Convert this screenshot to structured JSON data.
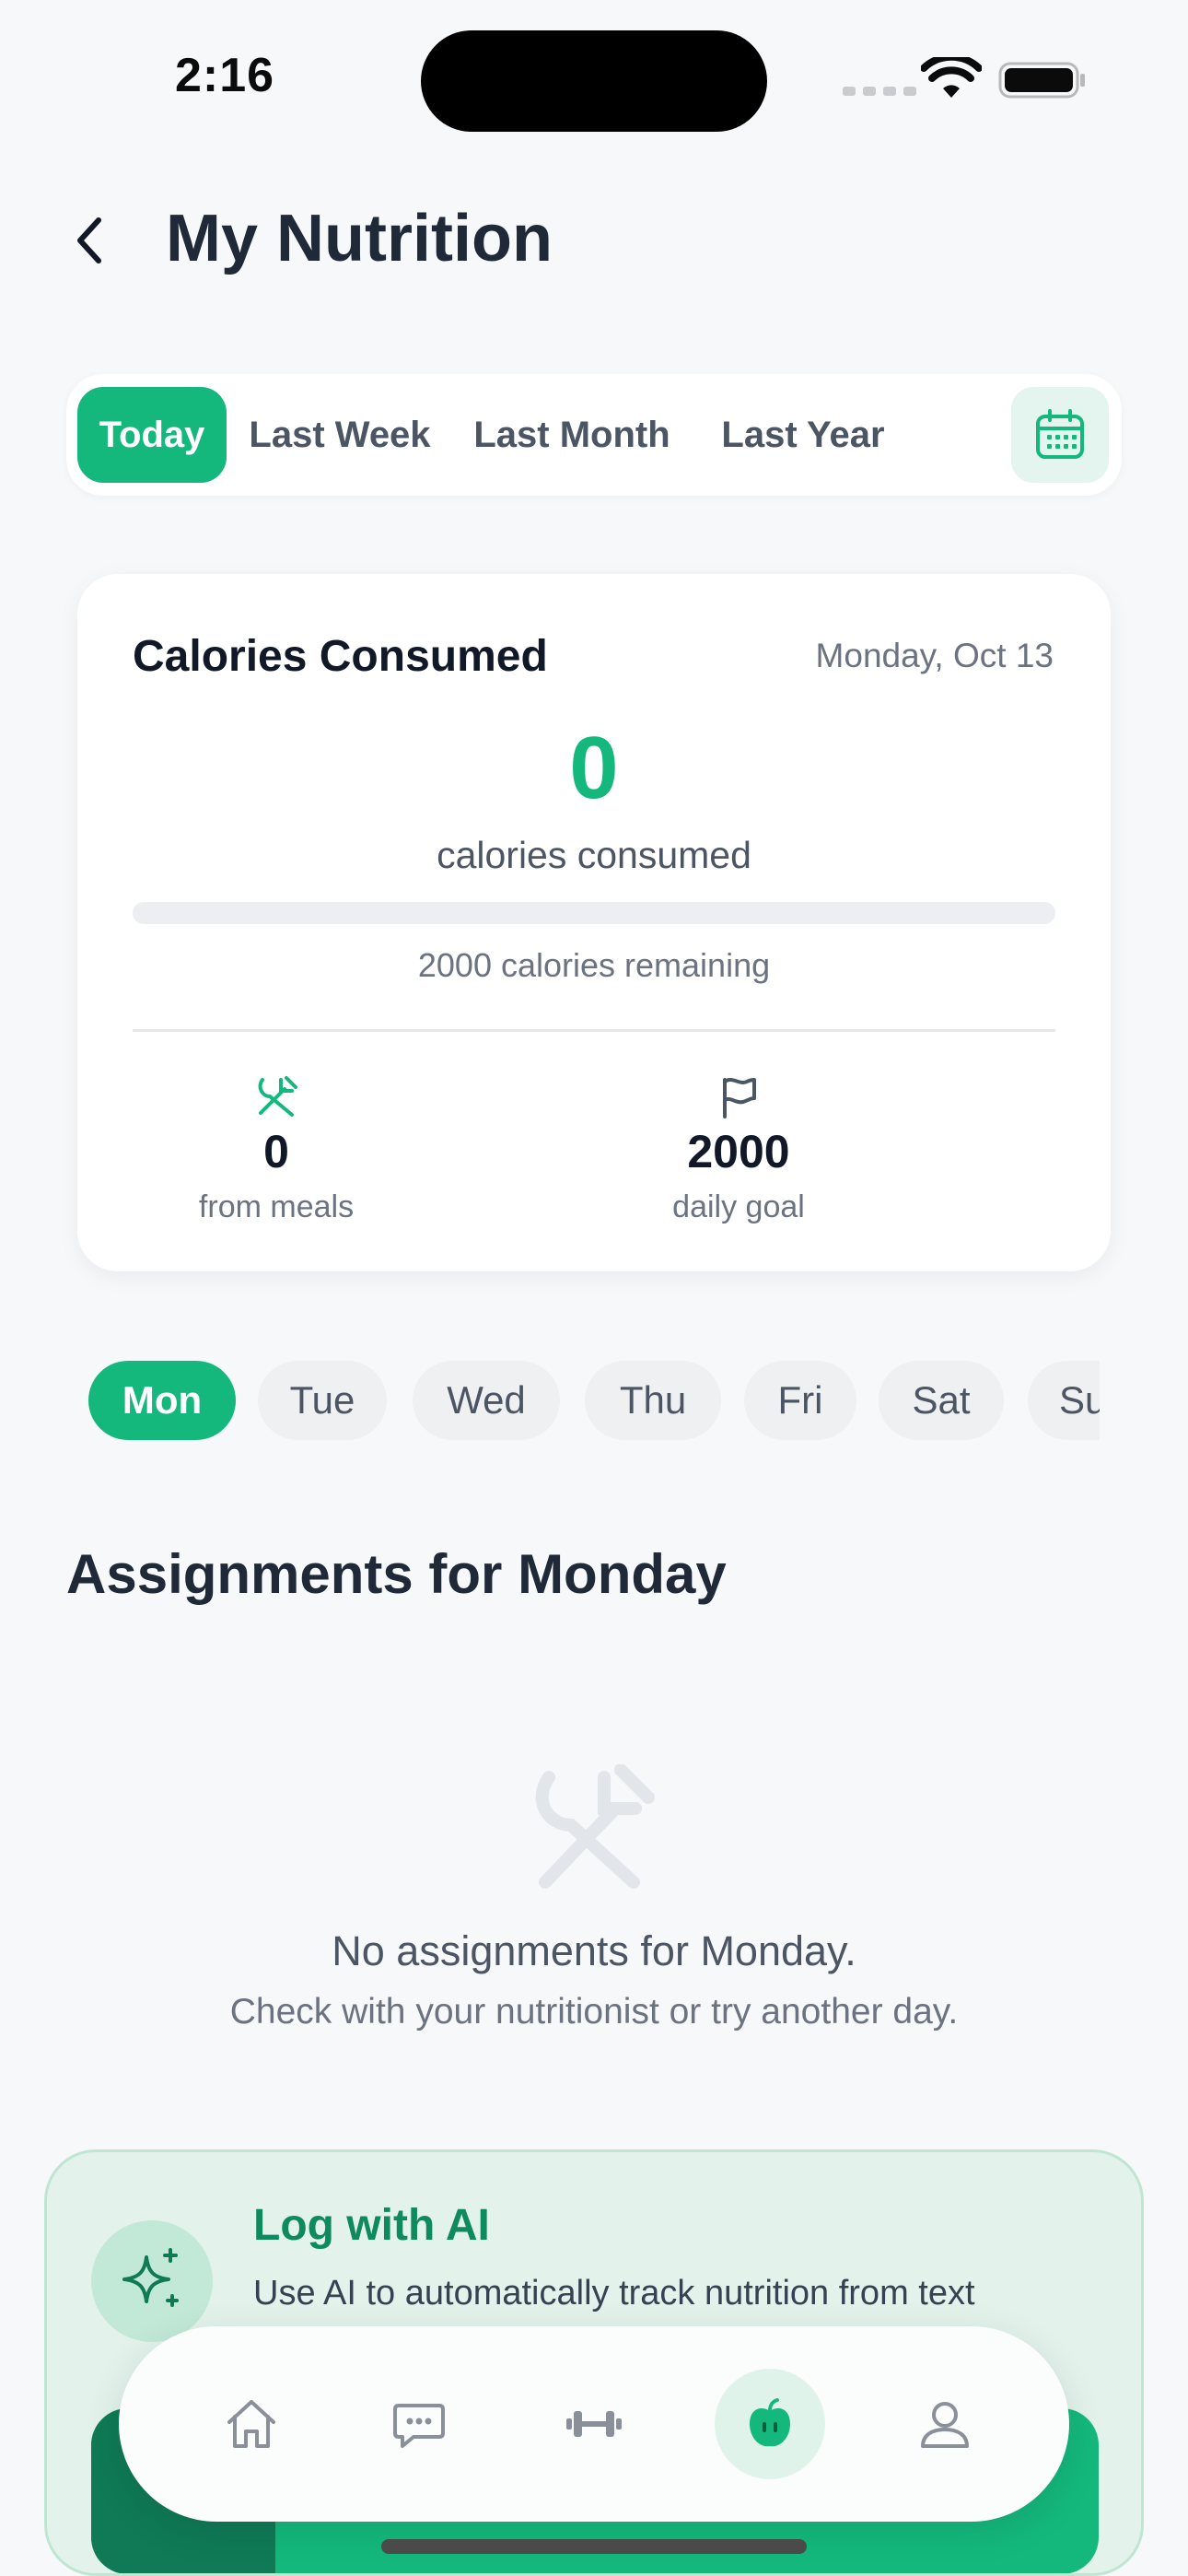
{
  "status_bar": {
    "time": "2:16"
  },
  "header": {
    "title": "My Nutrition"
  },
  "range_tabs": [
    {
      "label": "Today",
      "active": true
    },
    {
      "label": "Last Week",
      "active": false
    },
    {
      "label": "Last Month",
      "active": false
    },
    {
      "label": "Last Year",
      "active": false
    }
  ],
  "calories_card": {
    "title": "Calories Consumed",
    "date": "Monday, Oct 13",
    "consumed": "0",
    "consumed_label": "calories consumed",
    "progress_fraction": 0,
    "remaining_text": "2000 calories remaining",
    "stats": {
      "meals": {
        "value": "0",
        "label": "from meals",
        "icon": "utensils-icon"
      },
      "goal": {
        "value": "2000",
        "label": "daily goal",
        "icon": "flag-icon"
      }
    }
  },
  "days": [
    {
      "label": "Mon",
      "active": true
    },
    {
      "label": "Tue",
      "active": false
    },
    {
      "label": "Wed",
      "active": false
    },
    {
      "label": "Thu",
      "active": false
    },
    {
      "label": "Fri",
      "active": false
    },
    {
      "label": "Sat",
      "active": false
    },
    {
      "label": "Su",
      "active": false
    }
  ],
  "assignments": {
    "title": "Assignments for Monday",
    "empty_title": "No assignments for Monday.",
    "empty_subtitle": "Check with your nutritionist or try another day."
  },
  "ai_card": {
    "title": "Log with AI",
    "description": "Use AI to automatically track nutrition from text"
  },
  "nav": [
    {
      "icon": "home-icon",
      "active": false
    },
    {
      "icon": "chat-icon",
      "active": false
    },
    {
      "icon": "dumbbell-icon",
      "active": false
    },
    {
      "icon": "apple-icon",
      "active": true
    },
    {
      "icon": "profile-icon",
      "active": false
    }
  ],
  "colors": {
    "accent": "#14b87c",
    "accent_dark": "#0f8a5e",
    "background": "#f6f8fa"
  }
}
